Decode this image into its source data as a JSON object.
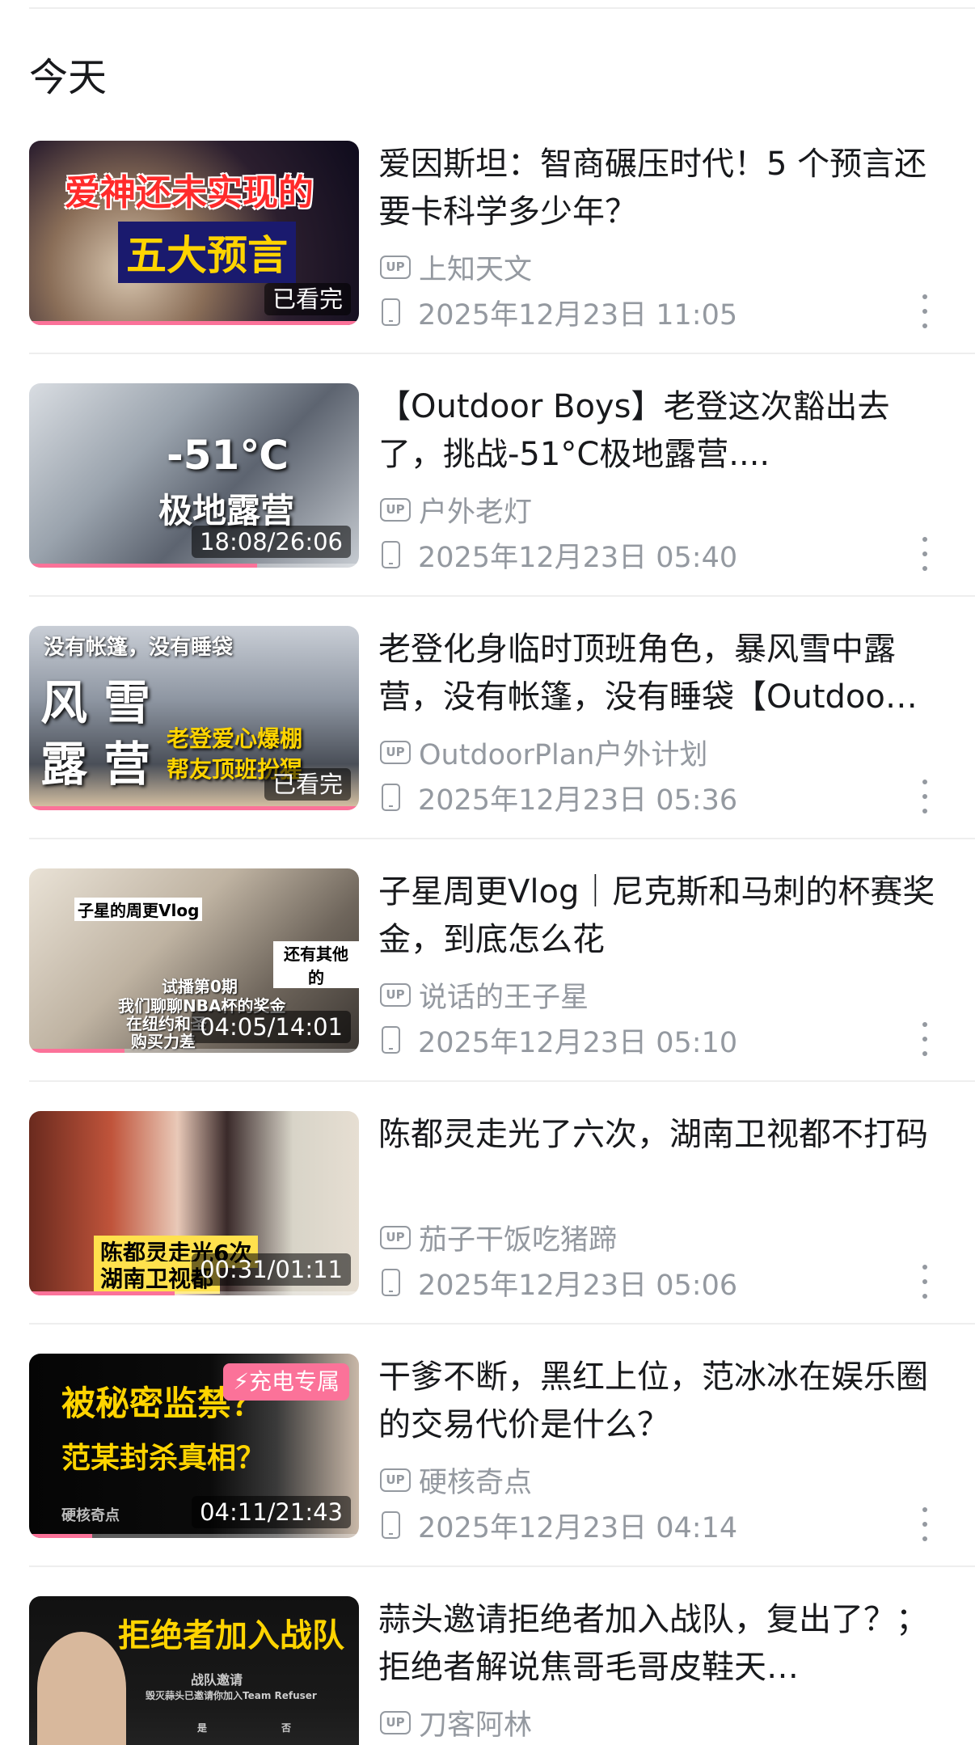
{
  "section_title": "今天",
  "items": [
    {
      "title": "爱因斯坦：智商碾压时代！5 个预言还要卡科学多少年？",
      "up": "上知天文",
      "time": "2025年12月23日 11:05",
      "badge": "已看完",
      "progress": 1.0,
      "thumb_text_1": "爱神还未实现的",
      "thumb_text_2": "五大预言"
    },
    {
      "title": "【Outdoor Boys】老登这次豁出去了，挑战-51°C极地露营....",
      "up": "户外老灯",
      "time": "2025年12月23日 05:40",
      "badge": "18:08/26:06",
      "progress": 0.69,
      "thumb_text_1": "-51℃",
      "thumb_text_2": "极地露营"
    },
    {
      "title": "老登化身临时顶班角色，暴风雪中露营，没有帐篷，没有睡袋【Outdoo…",
      "up": "OutdoorPlan户外计划",
      "time": "2025年12月23日 05:36",
      "badge": "已看完",
      "progress": 1.0,
      "thumb_text_1": "没有帐篷，没有睡袋",
      "thumb_text_2": "风雪",
      "thumb_text_3": "露营",
      "thumb_text_4": "老登爱心爆棚",
      "thumb_text_5": "帮友顶班扮猩"
    },
    {
      "title": "子星周更Vlog｜尼克斯和马刺的杯赛奖金，到底怎么花",
      "up": "说话的王子星",
      "time": "2025年12月23日 05:10",
      "badge": "04:05/14:01",
      "progress": 0.29,
      "thumb_text_1": "子星的周更Vlog",
      "thumb_text_2": "还有其他的",
      "thumb_text_3": "试播第0期",
      "thumb_text_4": "我们聊聊NBA杯的奖金",
      "thumb_text_5": "在纽约和圣",
      "thumb_text_6": "购买力差"
    },
    {
      "title": "陈都灵走光了六次，湖南卫视都不打码",
      "up": "茄子干饭吃猪蹄",
      "time": "2025年12月23日 05:06",
      "badge": "00:31/01:11",
      "progress": 0.44,
      "thumb_text_1": "陈都灵走光6次",
      "thumb_text_2": "湖南卫视都"
    },
    {
      "title": "干爹不断，黑红上位，范冰冰在娱乐圈的交易代价是什么？",
      "up": "硬核奇点",
      "time": "2025年12月23日 04:14",
      "badge": "04:11/21:43",
      "progress": 0.19,
      "charge_label": "充电专属",
      "thumb_text_1": "被秘密监禁？",
      "thumb_text_2": "范某封杀真相？",
      "thumb_text_3": "硬核奇点"
    },
    {
      "title": "蒜头邀请拒绝者加入战队，复出了？；拒绝者解说焦哥毛哥皮鞋天…",
      "up": "刀客阿林",
      "time": "",
      "badge": "",
      "progress": 0,
      "thumb_text_1": "拒绝者加入战队",
      "thumb_text_2": "战队邀请",
      "thumb_text_3": "毁灭蒜头已邀请你加入Team Refuser",
      "thumb_text_4": "是",
      "thumb_text_5": "否"
    }
  ],
  "up_icon_label": "UP",
  "colors": {
    "accent": "#fb7299",
    "meta": "#9499a0",
    "text": "#18191c"
  }
}
